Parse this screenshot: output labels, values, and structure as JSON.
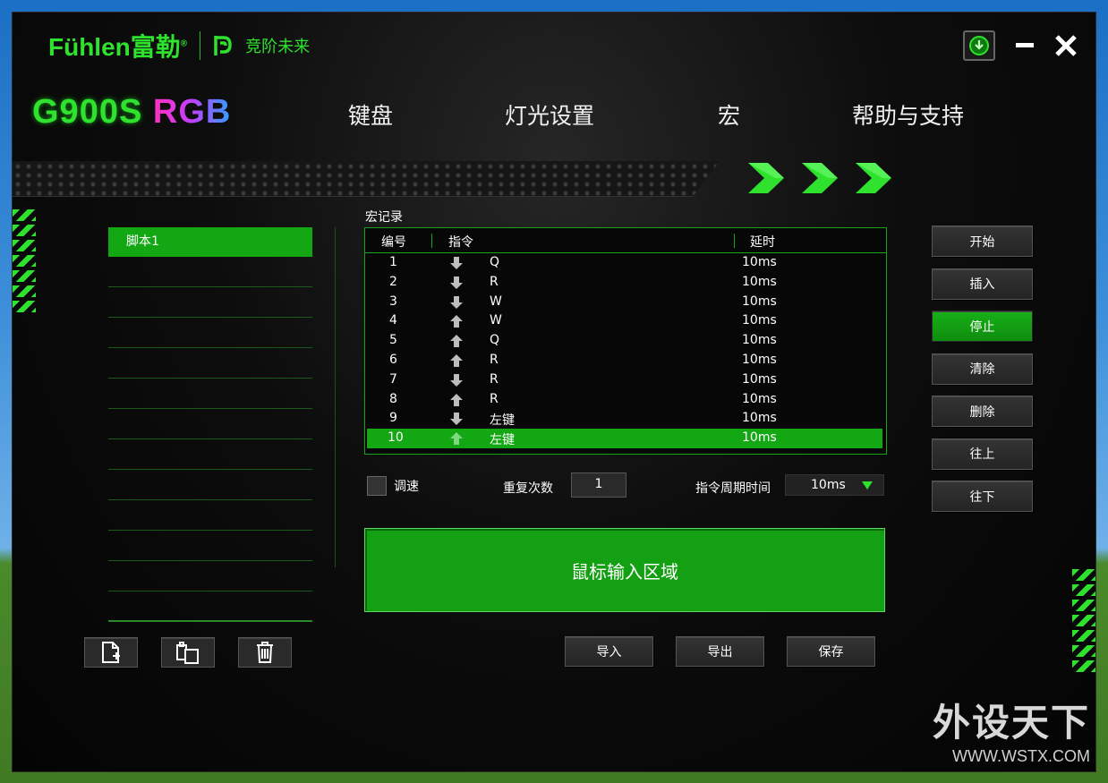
{
  "brand": {
    "logo": "Fühlen富勒",
    "registered": "®",
    "sub": "竞阶未来"
  },
  "window": {
    "download_icon": "download-icon",
    "minimize_icon": "minimize-icon",
    "close_icon": "close-icon"
  },
  "model": {
    "name": "G900S",
    "suffix": "RGB"
  },
  "nav": {
    "items": [
      "键盘",
      "灯光设置",
      "宏",
      "帮助与支持"
    ],
    "active": "宏"
  },
  "scripts": {
    "items": [
      "脚本1"
    ],
    "selected": "脚本1"
  },
  "macro": {
    "title": "宏记录",
    "columns": [
      "编号",
      "指令",
      "延时"
    ],
    "rows": [
      {
        "no": "1",
        "dir": "down",
        "key": "Q",
        "delay": "10ms"
      },
      {
        "no": "2",
        "dir": "down",
        "key": "R",
        "delay": "10ms"
      },
      {
        "no": "3",
        "dir": "down",
        "key": "W",
        "delay": "10ms"
      },
      {
        "no": "4",
        "dir": "up",
        "key": "W",
        "delay": "10ms"
      },
      {
        "no": "5",
        "dir": "up",
        "key": "Q",
        "delay": "10ms"
      },
      {
        "no": "6",
        "dir": "up",
        "key": "R",
        "delay": "10ms"
      },
      {
        "no": "7",
        "dir": "down",
        "key": "R",
        "delay": "10ms"
      },
      {
        "no": "8",
        "dir": "up",
        "key": "R",
        "delay": "10ms"
      },
      {
        "no": "9",
        "dir": "down",
        "key": "左键",
        "delay": "10ms"
      },
      {
        "no": "10",
        "dir": "up",
        "key": "左键",
        "delay": "10ms"
      }
    ],
    "selected_row": "10"
  },
  "options": {
    "speed_label": "调速",
    "repeat_label": "重复次数",
    "repeat_value": "1",
    "period_label": "指令周期时间",
    "period_value": "10ms"
  },
  "mouse_area": {
    "label": "鼠标输入区域"
  },
  "side_buttons": [
    "开始",
    "插入",
    "停止",
    "清除",
    "删除",
    "往上",
    "往下"
  ],
  "side_active": "停止",
  "bottom_buttons": {
    "import": "导入",
    "export": "导出",
    "save": "保存"
  },
  "list_tools": [
    "new-file-icon",
    "copy-icon",
    "trash-icon"
  ],
  "watermark": {
    "big": "外设天下",
    "small": "WWW.WSTX.COM"
  },
  "colors": {
    "accent": "#2ee22e",
    "selected": "#13a813",
    "panel": "#0d0d0d"
  }
}
